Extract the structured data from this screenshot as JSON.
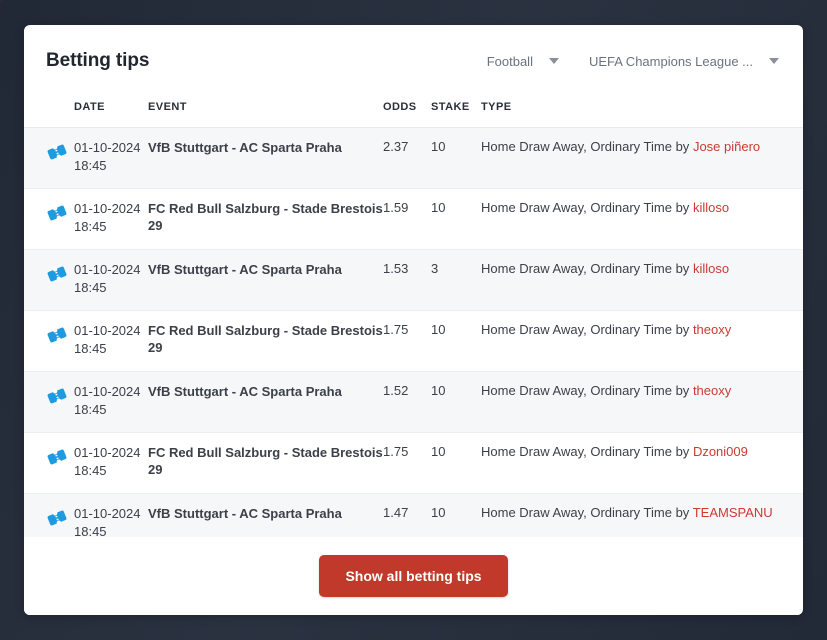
{
  "header": {
    "title": "Betting tips",
    "filters": [
      {
        "name": "sport-filter",
        "label": "Football",
        "icon": "chevron-down-icon"
      },
      {
        "name": "competition-filter",
        "label": "UEFA Champions League ...",
        "icon": "chevron-down-icon"
      }
    ]
  },
  "table": {
    "columns": [
      "DATE",
      "EVENT",
      "ODDS",
      "STAKE",
      "TYPE"
    ],
    "row_icon": "ticket-icon",
    "type_prefix": "Home Draw Away, Ordinary Time by",
    "rows": [
      {
        "date": "01-10-2024",
        "time": "18:45",
        "event": "VfB Stuttgart - AC Sparta Praha",
        "odds": "2.37",
        "stake": "10",
        "type_prefix": "Home Draw Away, Ordinary Time by",
        "user": "Jose piñero"
      },
      {
        "date": "01-10-2024",
        "time": "18:45",
        "event": "FC Red Bull Salzburg - Stade Brestois 29",
        "odds": "1.59",
        "stake": "10",
        "type_prefix": "Home Draw Away, Ordinary Time by",
        "user": "killoso"
      },
      {
        "date": "01-10-2024",
        "time": "18:45",
        "event": "VfB Stuttgart - AC Sparta Praha",
        "odds": "1.53",
        "stake": "3",
        "type_prefix": "Home Draw Away, Ordinary Time by",
        "user": "killoso"
      },
      {
        "date": "01-10-2024",
        "time": "18:45",
        "event": "FC Red Bull Salzburg - Stade Brestois 29",
        "odds": "1.75",
        "stake": "10",
        "type_prefix": "Home Draw Away, Ordinary Time by",
        "user": "theoxy"
      },
      {
        "date": "01-10-2024",
        "time": "18:45",
        "event": "VfB Stuttgart - AC Sparta Praha",
        "odds": "1.52",
        "stake": "10",
        "type_prefix": "Home Draw Away, Ordinary Time by",
        "user": "theoxy"
      },
      {
        "date": "01-10-2024",
        "time": "18:45",
        "event": "FC Red Bull Salzburg - Stade Brestois 29",
        "odds": "1.75",
        "stake": "10",
        "type_prefix": "Home Draw Away, Ordinary Time by",
        "user": "Dzoni009"
      },
      {
        "date": "01-10-2024",
        "time": "18:45",
        "event": "VfB Stuttgart - AC Sparta Praha",
        "odds": "1.47",
        "stake": "10",
        "type_prefix": "Home Draw Away, Ordinary Time by",
        "user": "TEAMSPANU"
      }
    ]
  },
  "footer": {
    "cta_label": "Show all betting tips"
  },
  "colors": {
    "page_background": "#262e3d",
    "card_background": "#ffffff",
    "stripe": "#f6f7f9",
    "cta": "#c0392b",
    "username": "#cc3a33",
    "ticket_icon": "#1e9ae0"
  }
}
